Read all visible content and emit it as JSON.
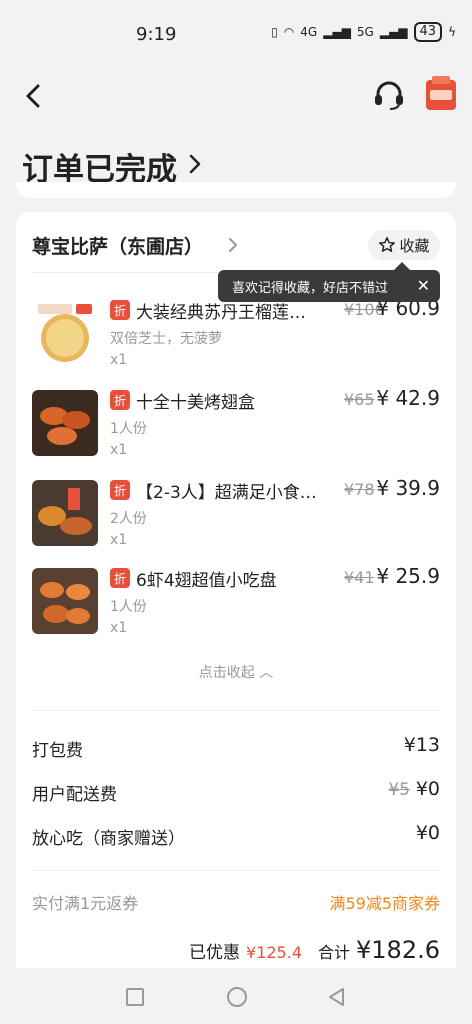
{
  "status": {
    "time": "9:19",
    "network": "4G",
    "network2": "5G",
    "battery": "43"
  },
  "header": {
    "title": "订单已完成"
  },
  "store": {
    "name": "尊宝比萨（东圃店）",
    "fav_label": "收藏"
  },
  "tooltip": {
    "text": "喜欢记得收藏，好店不错过",
    "close": "✕"
  },
  "items": [
    {
      "name": "大装经典苏丹王榴莲…",
      "spec": "双倍芝士，无菠萝",
      "qty": "x1",
      "orig": "¥106",
      "price": "¥ 60.9",
      "badge": "折"
    },
    {
      "name": "十全十美烤翅盒",
      "spec": "1人份",
      "qty": "x1",
      "orig": "¥65",
      "price": "¥ 42.9",
      "badge": "折"
    },
    {
      "name": "【2-3人】超满足小食…",
      "spec": "2人份",
      "qty": "x1",
      "orig": "¥78",
      "price": "¥ 39.9",
      "badge": "折"
    },
    {
      "name": "6虾4翅超值小吃盘",
      "spec": "1人份",
      "qty": "x1",
      "orig": "¥41",
      "price": "¥ 25.9",
      "badge": "折"
    }
  ],
  "collapse": {
    "label": "点击收起 ︿"
  },
  "fees": [
    {
      "label": "打包费",
      "value": "¥13",
      "orig": ""
    },
    {
      "label": "用户配送费",
      "value": "¥0",
      "orig": "¥5"
    },
    {
      "label": "放心吃（商家赠送）",
      "value": "¥0",
      "orig": ""
    }
  ],
  "coupon": {
    "label": "实付满1元返券",
    "value": "满59减5商家券"
  },
  "summary": {
    "saved_label": "已优惠",
    "saved_value": "¥125.4",
    "total_label": "合计",
    "total_value": "¥182.6"
  },
  "colors": {
    "accent_red": "#e8503a",
    "coupon_orange": "#f08a1c"
  },
  "icons": [
    "back-icon",
    "headset-icon",
    "promo-icon",
    "chevron-right-icon",
    "star-icon",
    "close-icon"
  ]
}
